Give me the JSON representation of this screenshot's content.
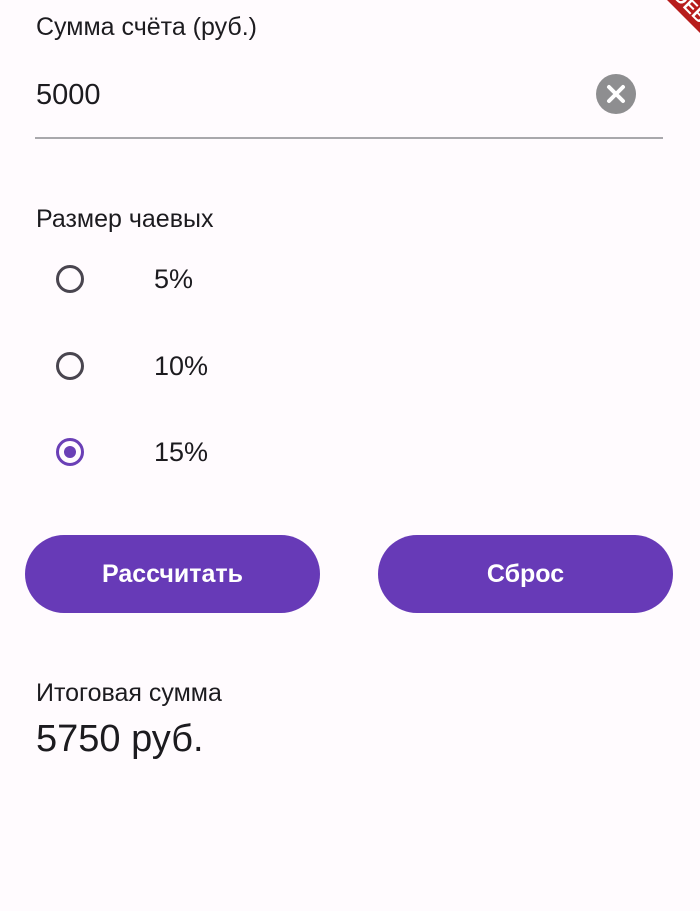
{
  "bill": {
    "label": "Сумма счёта (руб.)",
    "value": "5000",
    "clear_icon": "clear-icon"
  },
  "tip": {
    "label": "Размер чаевых",
    "options": [
      {
        "label": "5%",
        "selected": false
      },
      {
        "label": "10%",
        "selected": false
      },
      {
        "label": "15%",
        "selected": true
      }
    ],
    "selected_index": 2
  },
  "buttons": {
    "calculate_label": "Рассчитать",
    "reset_label": "Сброс"
  },
  "result": {
    "label": "Итоговая сумма",
    "value": "5750 руб."
  },
  "debug_banner": "DEBUG",
  "colors": {
    "accent": "#673ab7",
    "background": "#fffbfe",
    "text": "#1c1b1f",
    "debug_banner": "#b71c1c"
  }
}
